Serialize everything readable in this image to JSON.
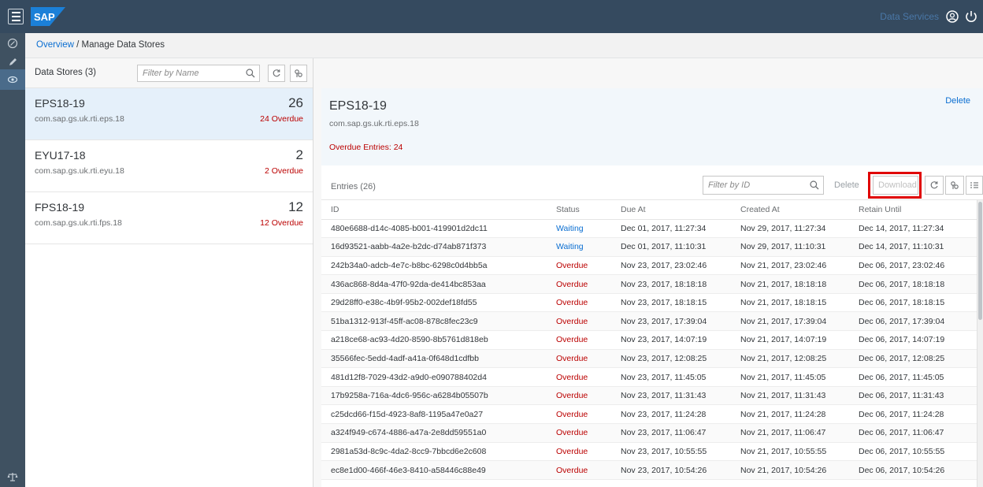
{
  "shell": {
    "logo_text": "SAP",
    "link_label": "Data Services",
    "colors": {
      "bar": "#354a5f",
      "rail": "#3f5161",
      "link": "#0a6ed1",
      "negative": "#bb0000",
      "highlight": "#e00000"
    }
  },
  "breadcrumb": {
    "root": "Overview",
    "separator": "/",
    "current": "Manage Data Stores"
  },
  "master": {
    "title": "Data Stores (3)",
    "filter_placeholder": "Filter by Name",
    "items": [
      {
        "name": "EPS18-19",
        "id": "com.sap.gs.uk.rti.eps.18",
        "count": "26",
        "overdue": "24 Overdue"
      },
      {
        "name": "EYU17-18",
        "id": "com.sap.gs.uk.rti.eyu.18",
        "count": "2",
        "overdue": "2 Overdue"
      },
      {
        "name": "FPS18-19",
        "id": "com.sap.gs.uk.rti.fps.18",
        "count": "12",
        "overdue": "12 Overdue"
      }
    ]
  },
  "detail": {
    "title": "EPS18-19",
    "subtitle": "com.sap.gs.uk.rti.eps.18",
    "overdue_entries": "Overdue Entries: 24",
    "delete_label": "Delete",
    "table": {
      "title": "Entries (26)",
      "filter_placeholder": "Filter by ID",
      "delete_label": "Delete",
      "download_label": "Download",
      "columns": [
        "ID",
        "Status",
        "Due At",
        "Created At",
        "Retain Until"
      ],
      "rows": [
        [
          "480e6688-d14c-4085-b001-419901d2dc11",
          "Waiting",
          "Dec 01, 2017, 11:27:34",
          "Nov 29, 2017, 11:27:34",
          "Dec 14, 2017, 11:27:34"
        ],
        [
          "16d93521-aabb-4a2e-b2dc-d74ab871f373",
          "Waiting",
          "Dec 01, 2017, 11:10:31",
          "Nov 29, 2017, 11:10:31",
          "Dec 14, 2017, 11:10:31"
        ],
        [
          "242b34a0-adcb-4e7c-b8bc-6298c0d4bb5a",
          "Overdue",
          "Nov 23, 2017, 23:02:46",
          "Nov 21, 2017, 23:02:46",
          "Dec 06, 2017, 23:02:46"
        ],
        [
          "436ac868-8d4a-47f0-92da-de414bc853aa",
          "Overdue",
          "Nov 23, 2017, 18:18:18",
          "Nov 21, 2017, 18:18:18",
          "Dec 06, 2017, 18:18:18"
        ],
        [
          "29d28ff0-e38c-4b9f-95b2-002def18fd55",
          "Overdue",
          "Nov 23, 2017, 18:18:15",
          "Nov 21, 2017, 18:18:15",
          "Dec 06, 2017, 18:18:15"
        ],
        [
          "51ba1312-913f-45ff-ac08-878c8fec23c9",
          "Overdue",
          "Nov 23, 2017, 17:39:04",
          "Nov 21, 2017, 17:39:04",
          "Dec 06, 2017, 17:39:04"
        ],
        [
          "a218ce68-ac93-4d20-8590-8b5761d818eb",
          "Overdue",
          "Nov 23, 2017, 14:07:19",
          "Nov 21, 2017, 14:07:19",
          "Dec 06, 2017, 14:07:19"
        ],
        [
          "35566fec-5edd-4adf-a41a-0f648d1cdfbb",
          "Overdue",
          "Nov 23, 2017, 12:08:25",
          "Nov 21, 2017, 12:08:25",
          "Dec 06, 2017, 12:08:25"
        ],
        [
          "481d12f8-7029-43d2-a9d0-e090788402d4",
          "Overdue",
          "Nov 23, 2017, 11:45:05",
          "Nov 21, 2017, 11:45:05",
          "Dec 06, 2017, 11:45:05"
        ],
        [
          "17b9258a-716a-4dc6-956c-a6284b05507b",
          "Overdue",
          "Nov 23, 2017, 11:31:43",
          "Nov 21, 2017, 11:31:43",
          "Dec 06, 2017, 11:31:43"
        ],
        [
          "c25dcd66-f15d-4923-8af8-1195a47e0a27",
          "Overdue",
          "Nov 23, 2017, 11:24:28",
          "Nov 21, 2017, 11:24:28",
          "Dec 06, 2017, 11:24:28"
        ],
        [
          "a324f949-c674-4886-a47a-2e8dd59551a0",
          "Overdue",
          "Nov 23, 2017, 11:06:47",
          "Nov 21, 2017, 11:06:47",
          "Dec 06, 2017, 11:06:47"
        ],
        [
          "2981a53d-8c9c-4da2-8cc9-7bbcd6e2c608",
          "Overdue",
          "Nov 23, 2017, 10:55:55",
          "Nov 21, 2017, 10:55:55",
          "Dec 06, 2017, 10:55:55"
        ],
        [
          "ec8e1d00-466f-46e3-8410-a58446c88e49",
          "Overdue",
          "Nov 23, 2017, 10:54:26",
          "Nov 21, 2017, 10:54:26",
          "Dec 06, 2017, 10:54:26"
        ]
      ]
    }
  },
  "icons": {
    "menu": "menu-icon",
    "user": "user-icon",
    "power": "power-icon",
    "rail": [
      "compass-icon",
      "edit-icon",
      "eye-icon",
      "scale-icon"
    ],
    "search": "search-icon",
    "refresh": "refresh-icon",
    "settings": "settings-icon",
    "group": "group-icon"
  }
}
